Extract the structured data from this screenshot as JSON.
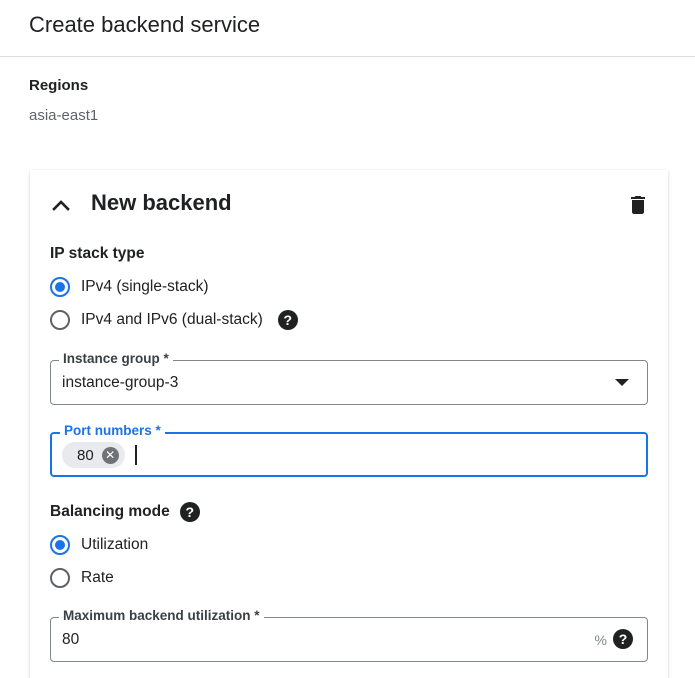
{
  "page": {
    "title": "Create backend service"
  },
  "regions": {
    "label": "Regions",
    "value": "asia-east1"
  },
  "backend": {
    "title": "New backend",
    "ip_stack": {
      "label": "IP stack type",
      "options": [
        {
          "label": "IPv4 (single-stack)",
          "selected": true
        },
        {
          "label": "IPv4 and IPv6 (dual-stack)",
          "selected": false
        }
      ]
    },
    "instance_group": {
      "label": "Instance group *",
      "value": "instance-group-3"
    },
    "port_numbers": {
      "label": "Port numbers *",
      "chips": [
        "80"
      ]
    },
    "balancing_mode": {
      "label": "Balancing mode",
      "options": [
        {
          "label": "Utilization",
          "selected": true
        },
        {
          "label": "Rate",
          "selected": false
        }
      ]
    },
    "max_utilization": {
      "label": "Maximum backend utilization *",
      "value": "80",
      "suffix": "%"
    }
  },
  "colors": {
    "accent": "#1a73e8",
    "text": "#202124",
    "muted": "#5f6368"
  }
}
